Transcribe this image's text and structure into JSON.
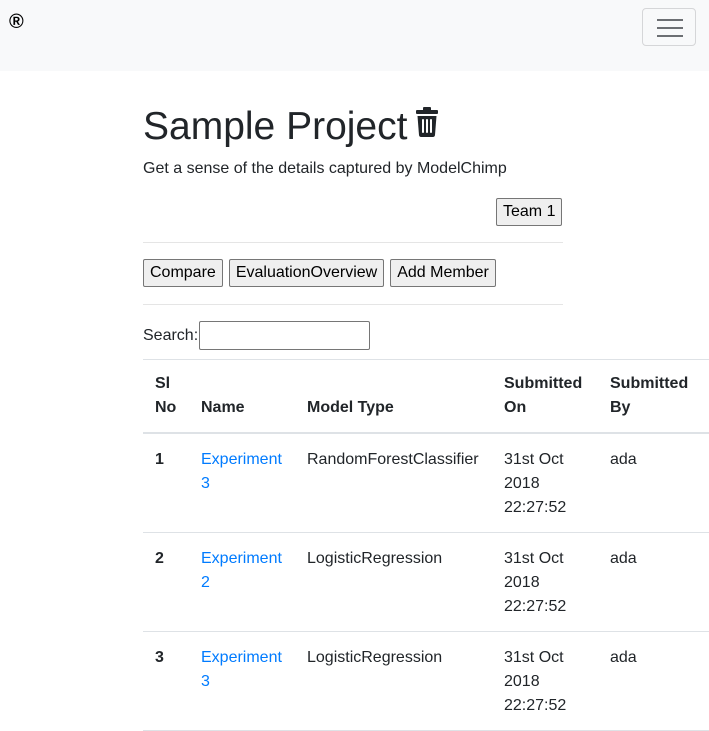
{
  "navbar": {
    "brand": "®",
    "menu_icon": "hamburger-icon"
  },
  "project": {
    "title": "Sample Project",
    "delete_icon": "trash-icon",
    "description": "Get a sense of the details captured by ModelChimp",
    "team_button": "Team 1"
  },
  "actions": {
    "compare": "Compare",
    "evaluation_overview": "EvaluationOverview",
    "add_member": "Add Member"
  },
  "search": {
    "label": "Search:",
    "value": ""
  },
  "table": {
    "headers": {
      "sl_no": "Sl No",
      "name": "Name",
      "model_type": "Model Type",
      "submitted_on": "Submitted On",
      "submitted_by": "Submitted By"
    },
    "rows": [
      {
        "sl_no": "1",
        "name": "Experiment 3",
        "model_type": "RandomForestClassifier",
        "submitted_on": "31st Oct 2018 22:27:52",
        "submitted_by": "ada"
      },
      {
        "sl_no": "2",
        "name": "Experiment 2",
        "model_type": "LogisticRegression",
        "submitted_on": "31st Oct 2018 22:27:52",
        "submitted_by": "ada"
      },
      {
        "sl_no": "3",
        "name": "Experiment 3",
        "model_type": "LogisticRegression",
        "submitted_on": "31st Oct 2018 22:27:52",
        "submitted_by": "ada"
      }
    ]
  },
  "colors": {
    "link": "#007bff",
    "navbar_bg": "#f8f9fa",
    "text": "#212529"
  }
}
